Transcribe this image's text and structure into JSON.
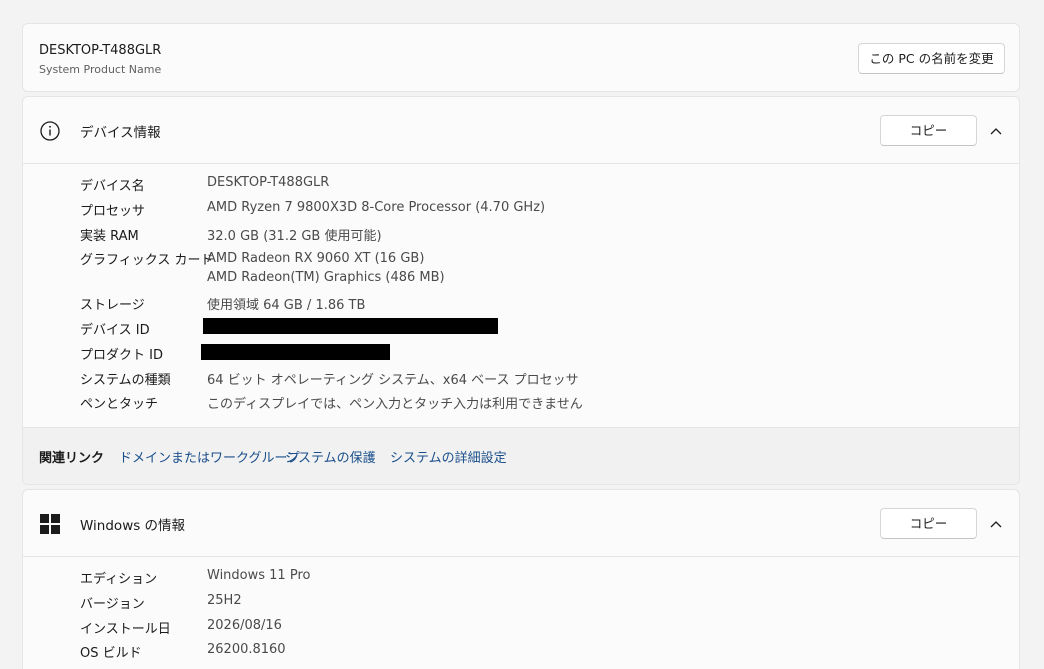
{
  "pc": {
    "name": "DESKTOP-T488GLR",
    "product_name": "System Product Name",
    "rename_button": "この PC の名前を変更"
  },
  "device_info": {
    "title": "デバイス情報",
    "copy_button": "コピー",
    "icon": "info-icon",
    "rows": [
      {
        "label": "デバイス名",
        "value": "DESKTOP-T488GLR"
      },
      {
        "label": "プロセッサ",
        "value": "AMD Ryzen 7 9800X3D 8-Core Processor (4.70 GHz)"
      },
      {
        "label": "実装 RAM",
        "value": "32.0 GB (31.2 GB 使用可能)"
      },
      {
        "label": "グラフィックス カード",
        "value": "AMD Radeon RX 9060 XT (16 GB)",
        "value2": "AMD Radeon(TM) Graphics (486 MB)"
      },
      {
        "label": "ストレージ",
        "value": "使用領域 64 GB / 1.86 TB"
      },
      {
        "label": "デバイス ID",
        "value": ""
      },
      {
        "label": "プロダクト ID",
        "value": ""
      },
      {
        "label": "システムの種類",
        "value": "64 ビット オペレーティング システム、x64 ベース プロセッサ"
      },
      {
        "label": "ペンとタッチ",
        "value": "このディスプレイでは、ペン入力とタッチ入力は利用できません"
      }
    ]
  },
  "related_links": {
    "label": "関連リンク",
    "links": [
      "ドメインまたはワークグループ",
      "システムの保護",
      "システムの詳細設定"
    ],
    "link_color": "#1a4f8b"
  },
  "windows_info": {
    "title": "Windows の情報",
    "copy_button": "コピー",
    "icon": "windows-logo-icon",
    "rows": [
      {
        "label": "エディション",
        "value": "Windows 11 Pro"
      },
      {
        "label": "バージョン",
        "value": "25H2"
      },
      {
        "label": "インストール日",
        "value": "2026/08/16"
      },
      {
        "label": "OS ビルド",
        "value": "26200.8160"
      }
    ]
  }
}
